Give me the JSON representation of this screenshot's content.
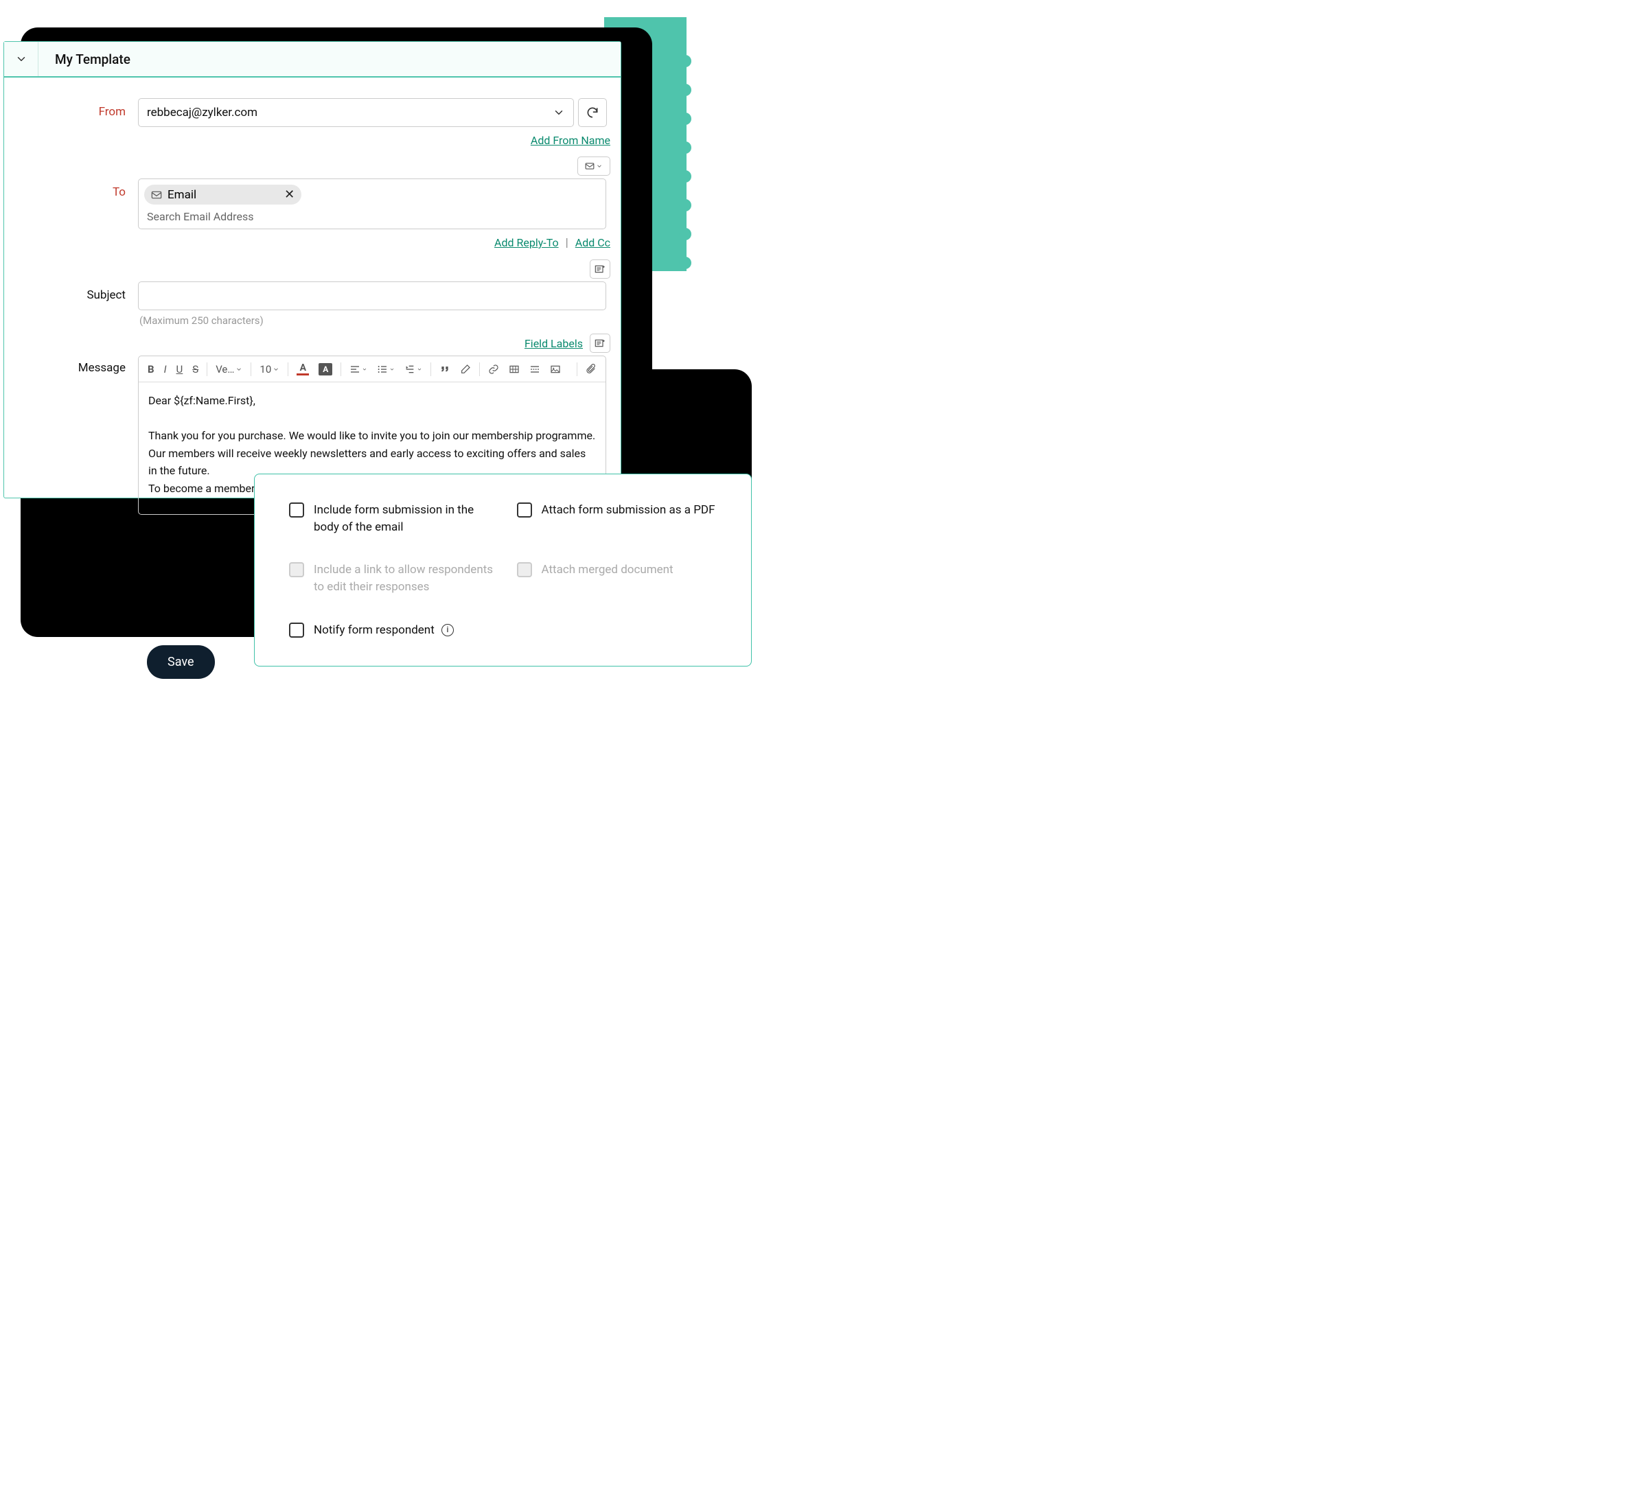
{
  "header": {
    "title": "My Template"
  },
  "from": {
    "label": "From",
    "value": "rebbecaj@zylker.com",
    "add_name_link": "Add From Name"
  },
  "to": {
    "label": "To",
    "chip_label": "Email",
    "search_placeholder": "Search Email Address",
    "add_reply_link": "Add Reply-To",
    "add_cc_link": "Add Cc"
  },
  "subject": {
    "label": "Subject",
    "helper": "(Maximum 250 characters)"
  },
  "message": {
    "label": "Message",
    "field_labels_link": "Field Labels",
    "toolbar": {
      "font_family": "Ve…",
      "font_size": "10"
    },
    "body_line1": "Dear ${zf:Name.First},",
    "body_line2": "Thank you for you purchase. We would like to invite you to join our membership programme. Our members will receive weekly newsletters and early access to exciting offers and sales in the future.",
    "body_line3": "To become a member, please click on this link."
  },
  "options": {
    "include_submission": "Include form submission in the body of the email",
    "attach_pdf": "Attach form submission as a PDF",
    "include_edit_link": "Include a link to allow respondents to edit their responses",
    "attach_merged": "Attach merged document",
    "notify_respondent": "Notify form respondent"
  },
  "save_button": "Save"
}
